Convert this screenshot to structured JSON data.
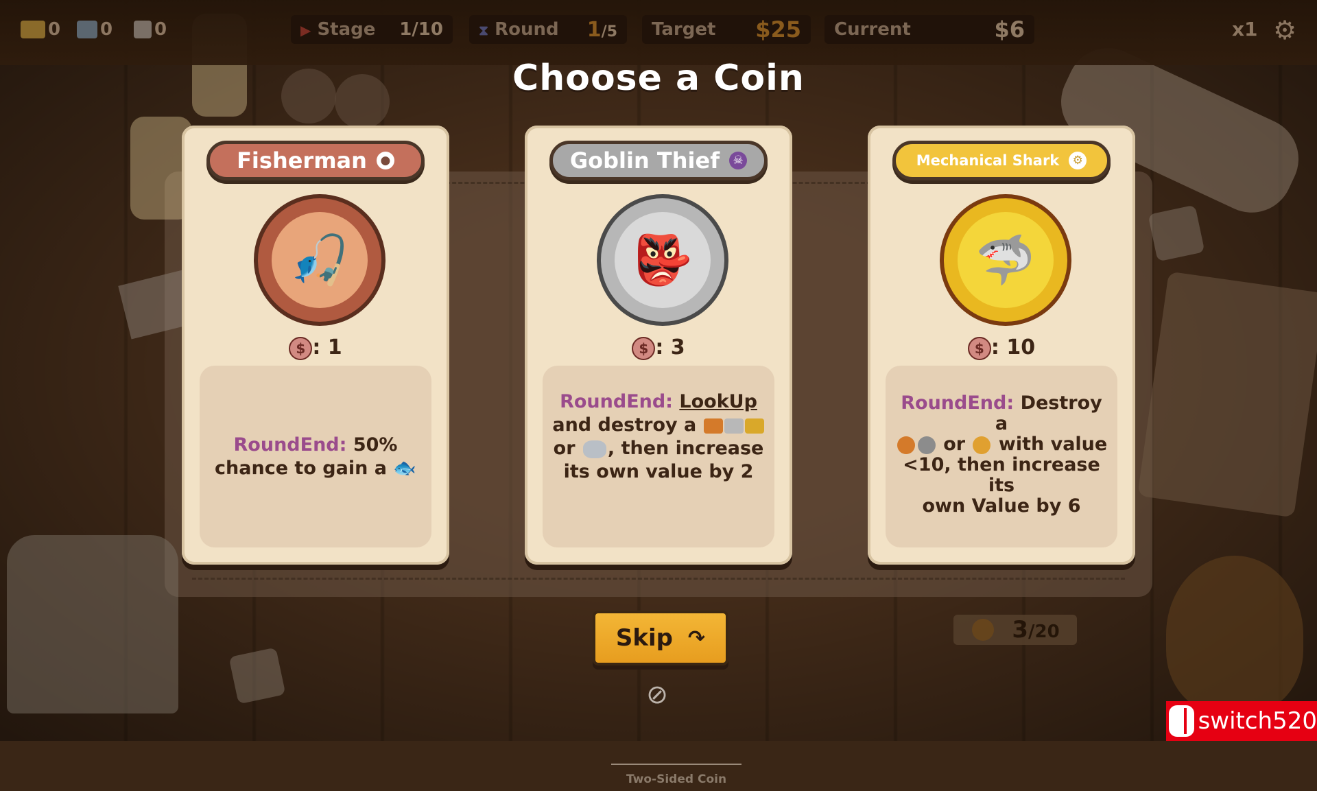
{
  "hud": {
    "resources": [
      {
        "name": "ticket",
        "value": "0",
        "color": "#8a6a2a"
      },
      {
        "name": "hammer",
        "value": "0",
        "color": "#5b6670"
      },
      {
        "name": "card",
        "value": "0",
        "color": "#7a6f66"
      }
    ],
    "stage": {
      "label": "Stage",
      "value": "1/10"
    },
    "round": {
      "label": "Round",
      "value": "1",
      "total": "/5"
    },
    "target": {
      "label": "Target",
      "value": "$25"
    },
    "current": {
      "label": "Current",
      "value": "$6"
    },
    "speed": "x1"
  },
  "title": "Choose a Coin",
  "cards": [
    {
      "name": "Fisherman",
      "banner_color": "#c4705c",
      "badge": "person",
      "cost": "1",
      "keyword": "RoundEnd:",
      "desc_1": "50%",
      "desc_2": "chance to gain a",
      "reward_icon": "fish-icon"
    },
    {
      "name": "Goblin Thief",
      "banner_color": "#a8a8a8",
      "badge": "skull",
      "cost": "3",
      "keyword": "RoundEnd:",
      "link": "LookUp",
      "desc_2": "and destroy a",
      "desc_3": "or",
      "desc_3b": ", then increase",
      "desc_4": "its own value by 2",
      "footer": "Two-Sided Coin"
    },
    {
      "name": "Mechanical Shark",
      "banner_color": "#f2c43c",
      "badge": "gear",
      "cost": "10",
      "keyword": "RoundEnd:",
      "desc_1": "Destroy a",
      "desc_2a": "or",
      "desc_2b": "with value",
      "desc_3": "<10, then increase its",
      "desc_4": "own Value by 6"
    }
  ],
  "skip_label": "Skip",
  "deck_counter": {
    "value": "3",
    "total": "/20"
  },
  "watermark": "switch520"
}
